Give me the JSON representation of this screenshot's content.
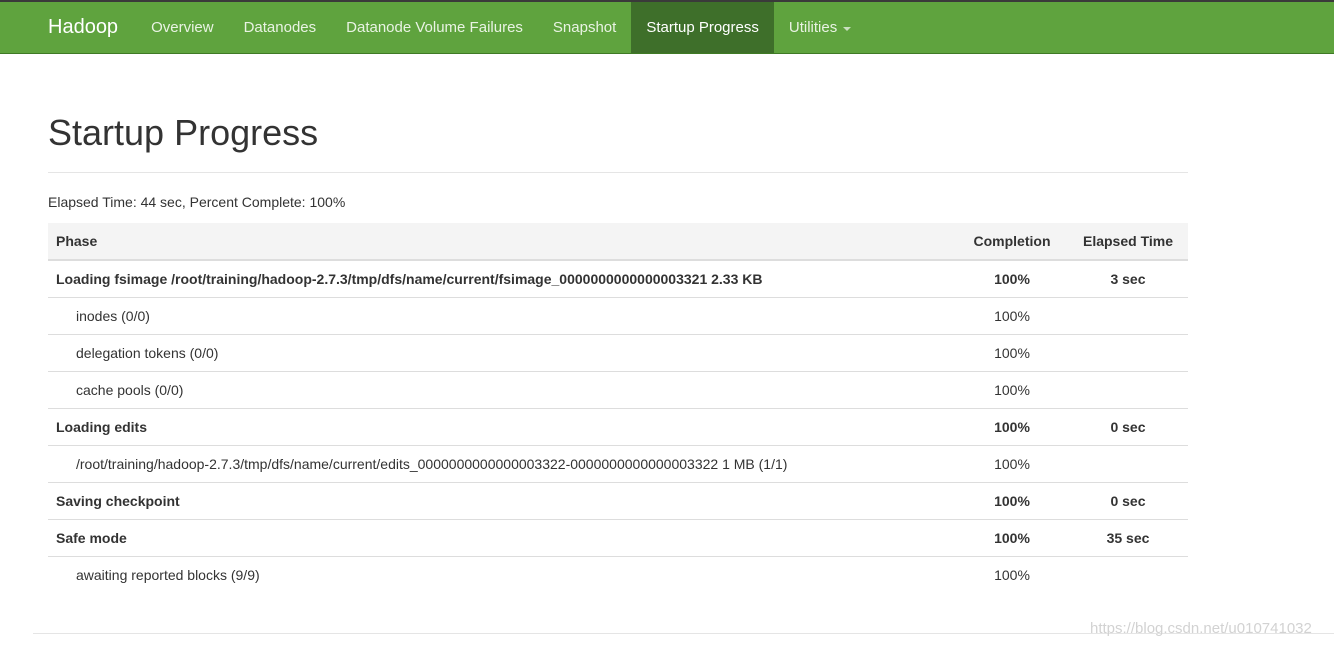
{
  "nav": {
    "brand": "Hadoop",
    "items": [
      {
        "label": "Overview"
      },
      {
        "label": "Datanodes"
      },
      {
        "label": "Datanode Volume Failures"
      },
      {
        "label": "Snapshot"
      },
      {
        "label": "Startup Progress"
      },
      {
        "label": "Utilities"
      }
    ]
  },
  "page": {
    "title": "Startup Progress",
    "summary": "Elapsed Time: 44 sec, Percent Complete: 100%"
  },
  "table": {
    "headers": {
      "phase": "Phase",
      "completion": "Completion",
      "elapsed": "Elapsed Time"
    },
    "rows": [
      {
        "phase": "Loading fsimage /root/training/hadoop-2.7.3/tmp/dfs/name/current/fsimage_0000000000000003321 2.33 KB",
        "completion": "100%",
        "elapsed": "3 sec"
      },
      {
        "phase": "inodes (0/0)",
        "completion": "100%",
        "elapsed": ""
      },
      {
        "phase": "delegation tokens (0/0)",
        "completion": "100%",
        "elapsed": ""
      },
      {
        "phase": "cache pools (0/0)",
        "completion": "100%",
        "elapsed": ""
      },
      {
        "phase": "Loading edits",
        "completion": "100%",
        "elapsed": "0 sec"
      },
      {
        "phase": "/root/training/hadoop-2.7.3/tmp/dfs/name/current/edits_0000000000000003322-0000000000000003322 1 MB (1/1)",
        "completion": "100%",
        "elapsed": ""
      },
      {
        "phase": "Saving checkpoint",
        "completion": "100%",
        "elapsed": "0 sec"
      },
      {
        "phase": "Safe mode",
        "completion": "100%",
        "elapsed": "35 sec"
      },
      {
        "phase": "awaiting reported blocks (9/9)",
        "completion": "100%",
        "elapsed": ""
      }
    ]
  },
  "watermark": "https://blog.csdn.net/u010741032",
  "colors": {
    "navbar": "#5fa33e",
    "nav_active": "#3e6f2a"
  }
}
